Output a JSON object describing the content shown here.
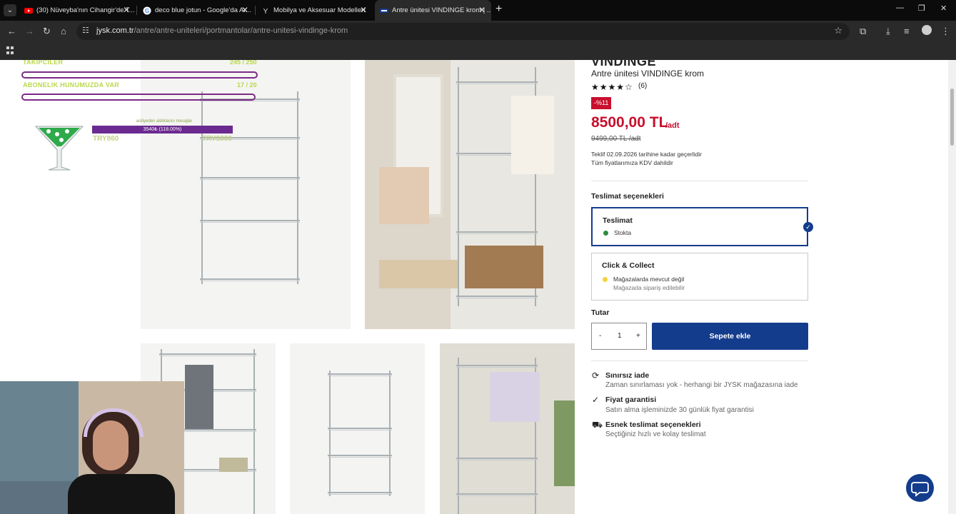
{
  "browser": {
    "tabs": [
      {
        "title": "(30) Nüveyba'nın Cihangir'de T...",
        "favicon": "youtube-icon",
        "active": false
      },
      {
        "title": "deco blue jotun - Google'da Ar...",
        "favicon": "google-icon",
        "active": false
      },
      {
        "title": "Mobilya ve Aksesuar Modelleri",
        "favicon": "y-icon",
        "active": false
      },
      {
        "title": "Antre ünitesi VINDINGE krom | ...",
        "favicon": "jysk-icon",
        "active": true
      }
    ],
    "url_domain": "jysk.com.tr",
    "url_path": "/antre/antre-uniteleri/portmantolar/antre-unitesi-vindinge-krom"
  },
  "overlay": {
    "followers_label": "TAKIPCILER",
    "followers_count": "245 / 250",
    "members_label": "ABONELIK HUNUMUZDA VAR",
    "members_count": "17 / 20",
    "goal_caption": "aciliyeden aldıklarını mesajlar",
    "goal_text": "3540₺ (118.00%)",
    "try_left": "TRY860",
    "try_right": "TRY3000"
  },
  "product": {
    "title_cut": "VINDINGE",
    "name": "Antre ünitesi VINDINGE krom",
    "rating": 4,
    "reviews": "(6)",
    "discount_badge": "-%11",
    "price": "8500,00 TL",
    "price_unit": "/adt",
    "old_price": "9499,00 TL /adt",
    "offer_line1": "Teklif 02.09.2026 tarihine kadar geçerlidir",
    "offer_line2": "Tüm fiyatlarımıza KDV dahildir"
  },
  "delivery": {
    "section_title": "Teslimat seçenekleri",
    "option1_title": "Teslimat",
    "option1_status": "Stokta",
    "option2_title": "Click & Collect",
    "option2_status": "Mağazalarda mevcut değil",
    "option2_sub": "Mağazada sipariş edilebilir",
    "colors": {
      "in_stock": "#2e8b3d",
      "not_available": "#f2d43a"
    }
  },
  "purchase": {
    "quantity_label": "Tutar",
    "minus": "-",
    "quantity": "1",
    "plus": "+",
    "add_to_cart": "Sepete ekle"
  },
  "usps": [
    {
      "title": "Sınırsız iade",
      "sub": "Zaman sınırlaması yok - herhangi bir JYSK mağazasına iade",
      "icon": "refresh-icon"
    },
    {
      "title": "Fiyat garantisi",
      "sub": "Satın alma işleminizde 30 günlük fiyat garantisi",
      "icon": "check-circle-icon"
    },
    {
      "title": "Esnek teslimat seçenekleri",
      "sub": "Seçtiğiniz hızlı ve kolay teslimat",
      "icon": "truck-icon"
    }
  ],
  "colors": {
    "brand": "#143c8c",
    "price": "#c8102e"
  }
}
